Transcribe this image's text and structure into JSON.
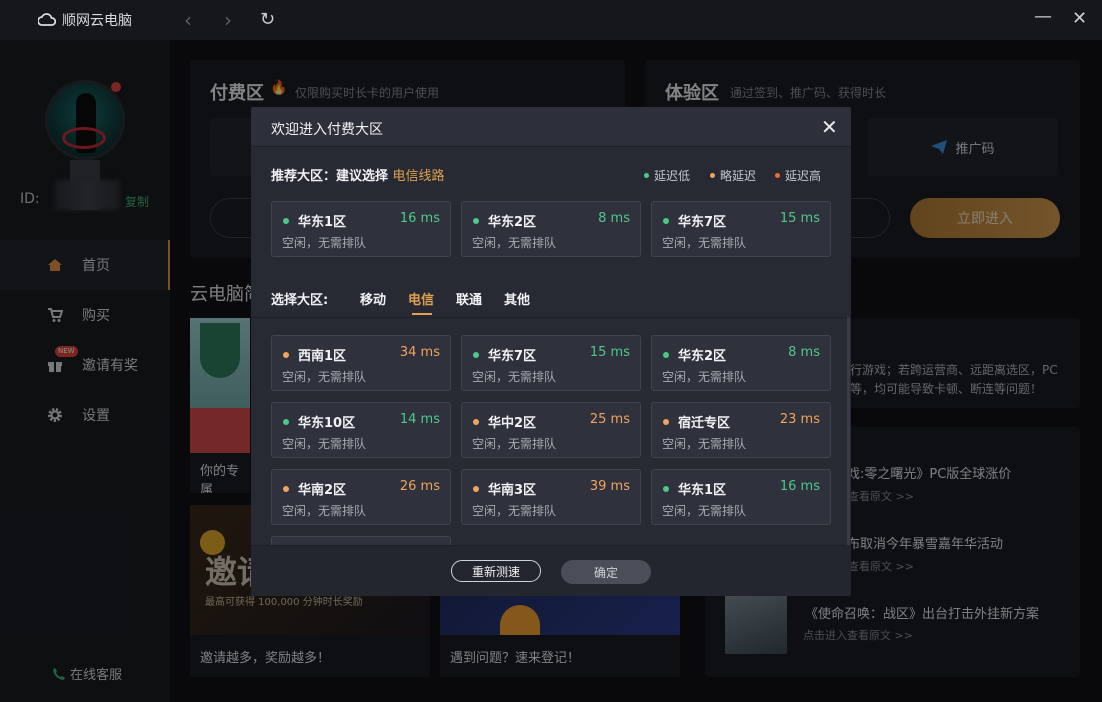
{
  "app": {
    "title": "顺网云电脑"
  },
  "colors": {
    "low": "#4fc98a",
    "mid": "#f0a45d",
    "high": "#ef6a3a",
    "accent": "#e0a050"
  },
  "sidebar": {
    "id_label": "ID:",
    "copy": "复制",
    "menu": [
      {
        "label": "首页",
        "icon": "home-icon"
      },
      {
        "label": "购买",
        "icon": "cart-icon"
      },
      {
        "label": "邀请有奖",
        "icon": "gift-icon",
        "badge": "NEW"
      },
      {
        "label": "设置",
        "icon": "gear-icon"
      }
    ],
    "support": "在线客服"
  },
  "background": {
    "paid_title": "付费区",
    "paid_sub": "仅限购买时长卡的用户使用",
    "trial_title": "体验区",
    "trial_sub": "通过签到、推广码、获得时长",
    "promo_code": "推广码",
    "enter_now": "立即进入",
    "section_title": "云电脑简",
    "notice_line1": "行游戏；若跨运营商、远距离选区，PC",
    "notice_line2": "等，均可能导致卡顿、断连等问题！",
    "card1_caption": "你的专属",
    "card2_caption": "邀请越多，奖励越多！",
    "card3_caption": "遇到问题？速来登记！",
    "invite_big": "邀请",
    "invite_sub": "最高可获得 100,000 分钟时长奖励",
    "news": [
      {
        "title": "戏:零之曙光》PC版全球涨价",
        "sub": "查看原文 >>"
      },
      {
        "title": "布取消今年暴雪嘉年华活动",
        "sub": "查看原文 >>"
      },
      {
        "title": "《使命召唤：战区》出台打击外挂新方案",
        "sub": "点击进入查看原文 >>"
      }
    ]
  },
  "modal": {
    "title": "欢迎进入付费大区",
    "recommend_prefix": "推荐大区：建议选择",
    "recommend_highlight": "电信线路",
    "legend": {
      "low": "延迟低",
      "mid": "略延迟",
      "high": "延迟高"
    },
    "recommended": [
      {
        "name": "华东1区",
        "ms": "16 ms",
        "status": "空闲，无需排队",
        "level": "low"
      },
      {
        "name": "华东2区",
        "ms": "8 ms",
        "status": "空闲，无需排队",
        "level": "low"
      },
      {
        "name": "华东7区",
        "ms": "15 ms",
        "status": "空闲，无需排队",
        "level": "low"
      }
    ],
    "select_label": "选择大区:",
    "tabs": [
      "移动",
      "电信",
      "联通",
      "其他"
    ],
    "active_tab": "电信",
    "servers": [
      {
        "name": "西南1区",
        "ms": "34 ms",
        "status": "空闲，无需排队",
        "level": "mid"
      },
      {
        "name": "华东7区",
        "ms": "15 ms",
        "status": "空闲，无需排队",
        "level": "low"
      },
      {
        "name": "华东2区",
        "ms": "8 ms",
        "status": "空闲，无需排队",
        "level": "low"
      },
      {
        "name": "华东10区",
        "ms": "14 ms",
        "status": "空闲，无需排队",
        "level": "low"
      },
      {
        "name": "华中2区",
        "ms": "25 ms",
        "status": "空闲，无需排队",
        "level": "mid"
      },
      {
        "name": "宿迁专区",
        "ms": "23 ms",
        "status": "空闲，无需排队",
        "level": "mid"
      },
      {
        "name": "华南2区",
        "ms": "26 ms",
        "status": "空闲，无需排队",
        "level": "mid"
      },
      {
        "name": "华南3区",
        "ms": "39 ms",
        "status": "空闲，无需排队",
        "level": "mid"
      },
      {
        "name": "华东1区",
        "ms": "16 ms",
        "status": "空闲，无需排队",
        "level": "low"
      }
    ],
    "retest": "重新测速",
    "confirm": "确定"
  }
}
